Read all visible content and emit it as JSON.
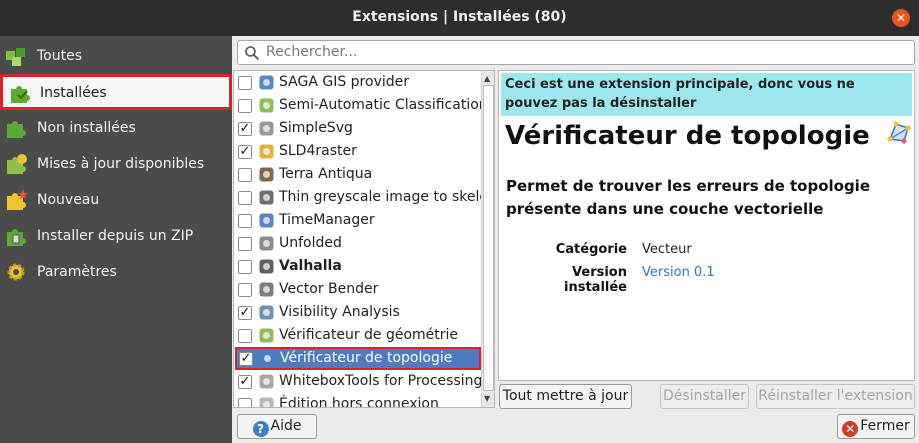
{
  "window": {
    "title": "Extensions | Installées (80)"
  },
  "sidebar": {
    "items": [
      {
        "label": "Toutes",
        "icon": "puzzle-multi-icon",
        "selected": false
      },
      {
        "label": "Installées",
        "icon": "puzzle-installed-icon",
        "selected": true
      },
      {
        "label": "Non installées",
        "icon": "puzzle-icon",
        "selected": false
      },
      {
        "label": "Mises à jour disponibles",
        "icon": "puzzle-update-icon",
        "selected": false
      },
      {
        "label": "Nouveau",
        "icon": "puzzle-new-icon",
        "selected": false
      },
      {
        "label": "Installer depuis un ZIP",
        "icon": "puzzle-zip-icon",
        "selected": false
      },
      {
        "label": "Paramètres",
        "icon": "gear-icon",
        "selected": false
      }
    ]
  },
  "search": {
    "placeholder": "Rechercher..."
  },
  "plugins": [
    {
      "name": "SAGA GIS provider",
      "checked": false,
      "bold": false,
      "icon": "saga-icon"
    },
    {
      "name": "Semi-Automatic Classification",
      "checked": false,
      "bold": false,
      "icon": "scp-icon"
    },
    {
      "name": "SimpleSvg",
      "checked": true,
      "bold": false,
      "icon": "svg-icon"
    },
    {
      "name": "SLD4raster",
      "checked": true,
      "bold": false,
      "icon": "sld-icon"
    },
    {
      "name": "Terra Antiqua",
      "checked": false,
      "bold": false,
      "icon": "terra-icon"
    },
    {
      "name": "Thin greyscale image to skelet",
      "checked": false,
      "bold": false,
      "icon": "skeleton-icon"
    },
    {
      "name": "TimeManager",
      "checked": false,
      "bold": false,
      "icon": "time-icon"
    },
    {
      "name": "Unfolded",
      "checked": false,
      "bold": false,
      "icon": "unfolded-icon"
    },
    {
      "name": "Valhalla",
      "checked": false,
      "bold": true,
      "icon": "valhalla-icon"
    },
    {
      "name": "Vector Bender",
      "checked": false,
      "bold": false,
      "icon": "bender-icon"
    },
    {
      "name": "Visibility Analysis",
      "checked": true,
      "bold": false,
      "icon": "visibility-icon"
    },
    {
      "name": "Vérificateur de géométrie",
      "checked": false,
      "bold": false,
      "icon": "geometry-icon"
    },
    {
      "name": "Vérificateur de topologie",
      "checked": true,
      "bold": false,
      "icon": "topology-icon",
      "selected": true
    },
    {
      "name": "WhiteboxTools for Processing",
      "checked": true,
      "bold": false,
      "icon": "whitebox-icon"
    },
    {
      "name": "Édition hors connexion",
      "checked": false,
      "bold": false,
      "icon": "offline-icon"
    }
  ],
  "details": {
    "banner": "Ceci est une extension principale, donc vous ne pouvez pas la désinstaller",
    "title": "Vérificateur de topologie",
    "description": "Permet de trouver les erreurs de topologie présente dans une couche vectorielle",
    "category_label": "Catégorie",
    "category_value": "Vecteur",
    "version_label": "Version installée",
    "version_value": "Version 0.1"
  },
  "buttons": {
    "update_all": "Tout mettre à jour",
    "uninstall": "Désinstaller",
    "reinstall": "Réinstaller l'extension",
    "help": "Aide",
    "close": "Fermer"
  },
  "colors": {
    "accent": "#4e7bc1",
    "highlight": "#d8232a",
    "banner": "#9fe7ef",
    "link": "#2a7ab8"
  }
}
